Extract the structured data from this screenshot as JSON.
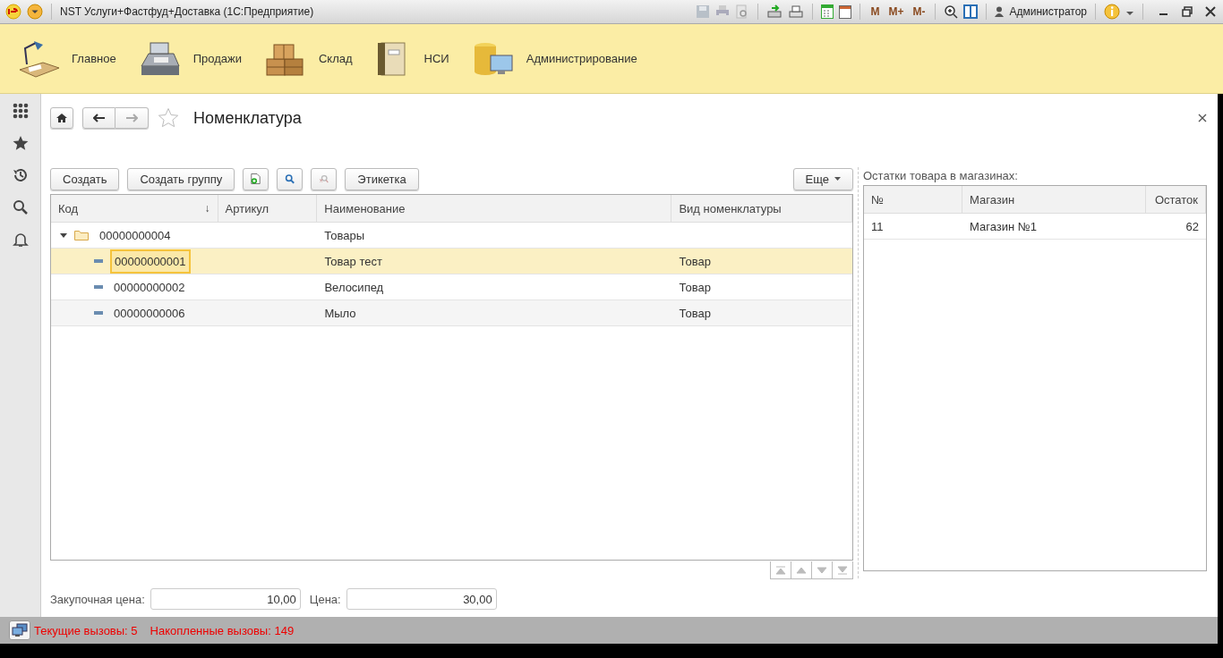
{
  "window": {
    "title": "NST Услуги+Фастфуд+Доставка  (1С:Предприятие)",
    "user": "Администратор",
    "memory_buttons": [
      "M",
      "M+",
      "M-"
    ]
  },
  "sections": [
    {
      "label": "Главное",
      "kind": "desk"
    },
    {
      "label": "Продажи",
      "kind": "register"
    },
    {
      "label": "Склад",
      "kind": "boxes"
    },
    {
      "label": "НСИ",
      "kind": "binder"
    },
    {
      "label": "Администрирование",
      "kind": "admin"
    }
  ],
  "form": {
    "title": "Номенклатура",
    "favorite": false,
    "buttons": [
      {
        "label": "Создать"
      },
      {
        "label": "Создать группу"
      }
    ],
    "label_button": "Этикетка",
    "more_button": "Еще",
    "table": {
      "columns": [
        {
          "label": "Код",
          "sort_mark": "↓"
        },
        {
          "label": "Артикул"
        },
        {
          "label": "Наименование"
        },
        {
          "label": "Вид номенклатуры"
        }
      ],
      "rows": [
        {
          "kind": "group",
          "code": "00000000004",
          "name": "Товары",
          "expanded": true,
          "selected": false,
          "children": [
            {
              "kind": "item",
              "code": "00000000001",
              "name": "Товар тест",
              "type": "Товар",
              "selected": true
            },
            {
              "kind": "item",
              "code": "00000000002",
              "name": "Велосипед",
              "type": "Товар",
              "selected": false
            },
            {
              "kind": "item",
              "code": "00000000006",
              "name": "Мыло",
              "type": "Товар",
              "selected": false
            }
          ]
        }
      ]
    },
    "stock": {
      "caption": "Остатки товара в магазинах:",
      "columns": [
        "№",
        "Магазин",
        "Остаток"
      ],
      "rows": [
        {
          "number": "11",
          "store": "Магазин №1",
          "quantity": "62"
        }
      ]
    },
    "fields": [
      {
        "label": "Закупочная цена:",
        "value": "10,00"
      },
      {
        "label": "Цена:",
        "value": "30,00"
      }
    ]
  },
  "status_bar": {
    "current_calls": "Текущие вызовы: 5",
    "accumulated_calls": "Накопленные вызовы: 149"
  }
}
